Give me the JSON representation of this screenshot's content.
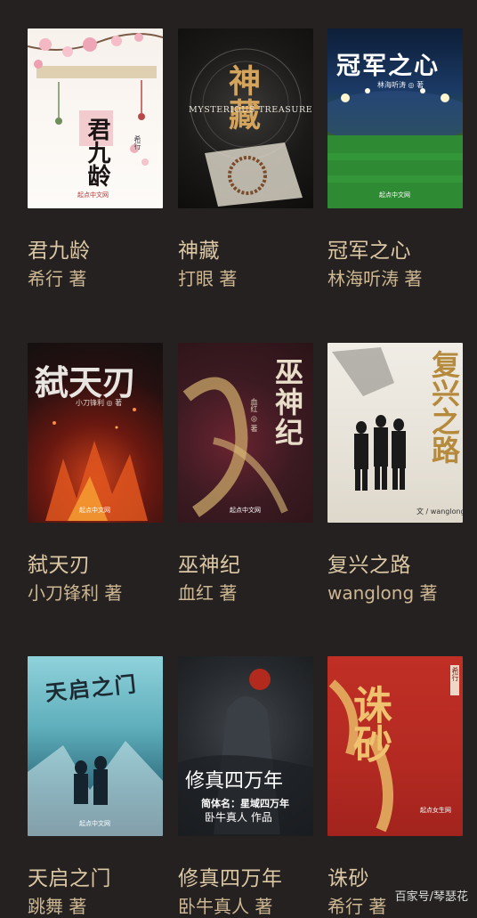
{
  "books": [
    {
      "title": "君九龄",
      "author": "希行 著",
      "cover": {
        "title": "君九龄",
        "author": "希行",
        "publisher": "起点中文网",
        "icon": "book-cover-icon"
      }
    },
    {
      "title": "神藏",
      "author": "打眼 著",
      "cover": {
        "title": "神藏",
        "subtitle": "MYSTERIOUS TREASURE",
        "author": "",
        "publisher": "",
        "icon": "book-cover-icon"
      }
    },
    {
      "title": "冠军之心",
      "author": "林海听涛 著",
      "cover": {
        "title": "冠军之心",
        "author": "林海听涛 ◎ 著",
        "publisher": "起点中文网",
        "icon": "book-cover-icon"
      }
    },
    {
      "title": "弑天刃",
      "author": "小刀锋利 著",
      "cover": {
        "title": "弑天刃",
        "author": "小刀锋利 ◎ 著",
        "publisher": "起点中文网",
        "icon": "book-cover-icon"
      }
    },
    {
      "title": "巫神纪",
      "author": "血红 著",
      "cover": {
        "title": "巫神纪",
        "author": "血红 ◎ 著",
        "publisher": "起点中文网",
        "icon": "book-cover-icon"
      }
    },
    {
      "title": "复兴之路",
      "author": "wanglong 著",
      "cover": {
        "title": "复兴之路",
        "author": "文 / wanglong",
        "publisher": "",
        "icon": "book-cover-icon"
      }
    },
    {
      "title": "天启之门",
      "author": "跳舞 著",
      "cover": {
        "title": "天启之门",
        "author": "",
        "publisher": "起点中文网",
        "icon": "book-cover-icon"
      }
    },
    {
      "title": "修真四万年",
      "author": "卧牛真人 著",
      "cover": {
        "title": "修真四万年",
        "line1": "简体名：星域四万年",
        "line2": "卧牛真人 作品",
        "publisher": "",
        "icon": "book-cover-icon"
      }
    },
    {
      "title": "诛砂",
      "author": "希行 著",
      "cover": {
        "title": "诛砂",
        "author": "希行",
        "publisher": "起点女生网",
        "icon": "book-cover-icon"
      }
    }
  ],
  "watermark": "百家号/琴瑟花"
}
